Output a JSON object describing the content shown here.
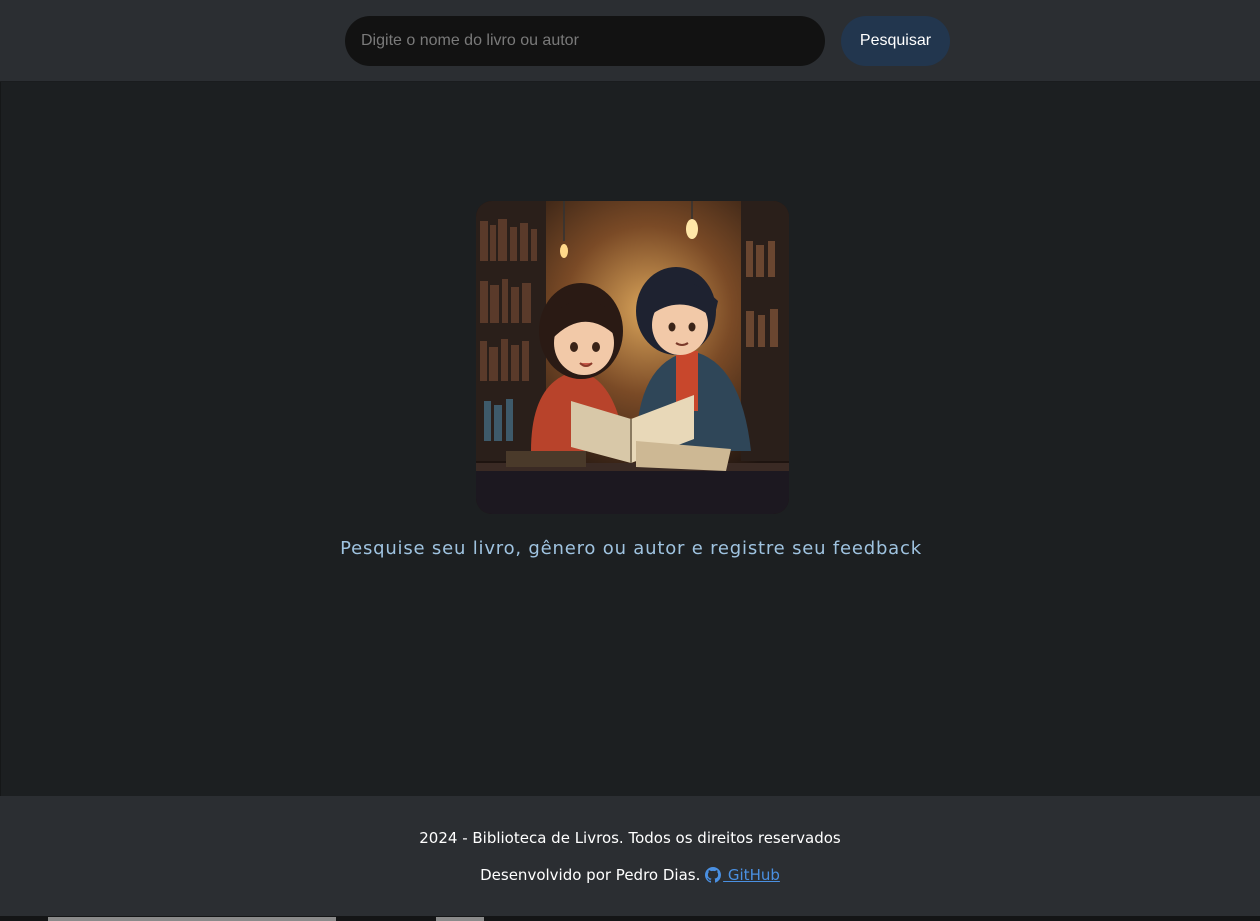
{
  "search": {
    "placeholder": "Digite o nome do livro ou autor",
    "value": "",
    "button_label": "Pesquisar"
  },
  "hero": {
    "image_icon": "reading-children-illustration",
    "tagline": "Pesquise seu livro, gênero ou autor e registre seu feedback"
  },
  "footer": {
    "copyright": "2024 - Biblioteca de Livros. Todos os direitos reservados",
    "developer": "Desenvolvido por Pedro Dias.",
    "github_label": " GitHub",
    "github_icon": "github-icon"
  },
  "colors": {
    "header_bg": "#2b2e32",
    "main_bg": "#1c1f21",
    "search_input_bg": "#121212",
    "search_button_bg": "#22364e",
    "tagline": "#9fc3e0",
    "link": "#4a90e2"
  }
}
